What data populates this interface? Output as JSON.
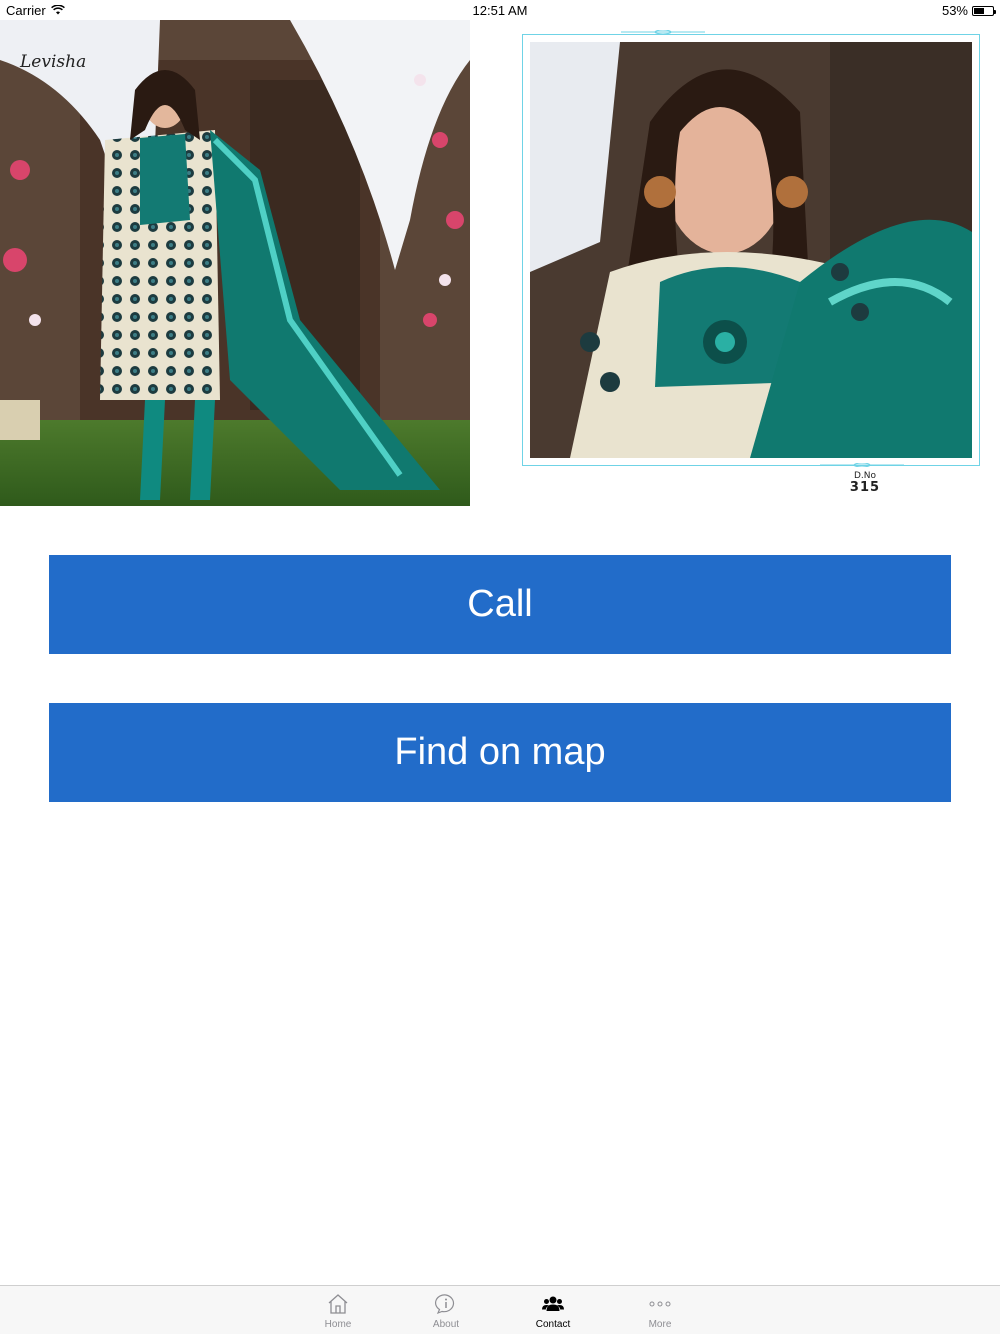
{
  "status_bar": {
    "carrier": "Carrier",
    "time": "12:51 AM",
    "battery_percent": "53%",
    "battery_level": 0.53
  },
  "gallery": {
    "logo_text": "Levisha",
    "dno_label": "D.No",
    "dno_number": "315",
    "colors": {
      "frame": "#6fd3e6",
      "teal": "#0f8a80"
    }
  },
  "actions": {
    "call_label": "Call",
    "map_label": "Find on map",
    "button_color": "#226cc9"
  },
  "tab_bar": {
    "tabs": [
      {
        "label": "Home",
        "icon": "home-icon"
      },
      {
        "label": "About",
        "icon": "info-bubble-icon"
      },
      {
        "label": "Contact",
        "icon": "people-icon"
      },
      {
        "label": "More",
        "icon": "more-dots-icon"
      }
    ],
    "active": "Contact"
  }
}
